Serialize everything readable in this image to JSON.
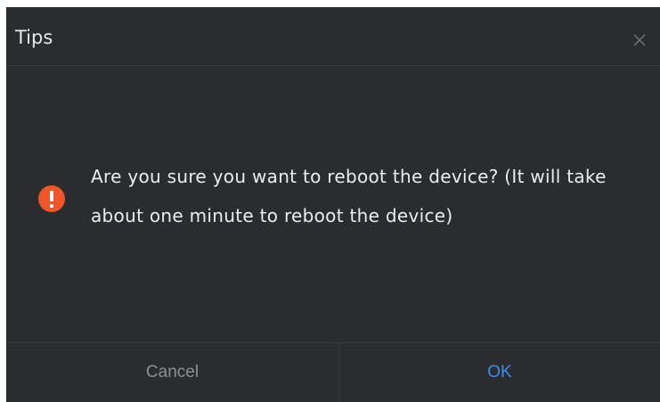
{
  "dialog": {
    "title": "Tips",
    "close_icon": "close-icon",
    "warning_icon": "exclamation-circle-icon",
    "message": "Are you sure you want to reboot the device? (It will take about one minute to reboot the device)",
    "buttons": {
      "cancel_label": "Cancel",
      "ok_label": "OK"
    }
  },
  "colors": {
    "background": "#2b2c30",
    "warning": "#f0562a",
    "ok_text": "#3c8ee8",
    "cancel_text": "#8f9095",
    "message_text": "#ececec"
  }
}
